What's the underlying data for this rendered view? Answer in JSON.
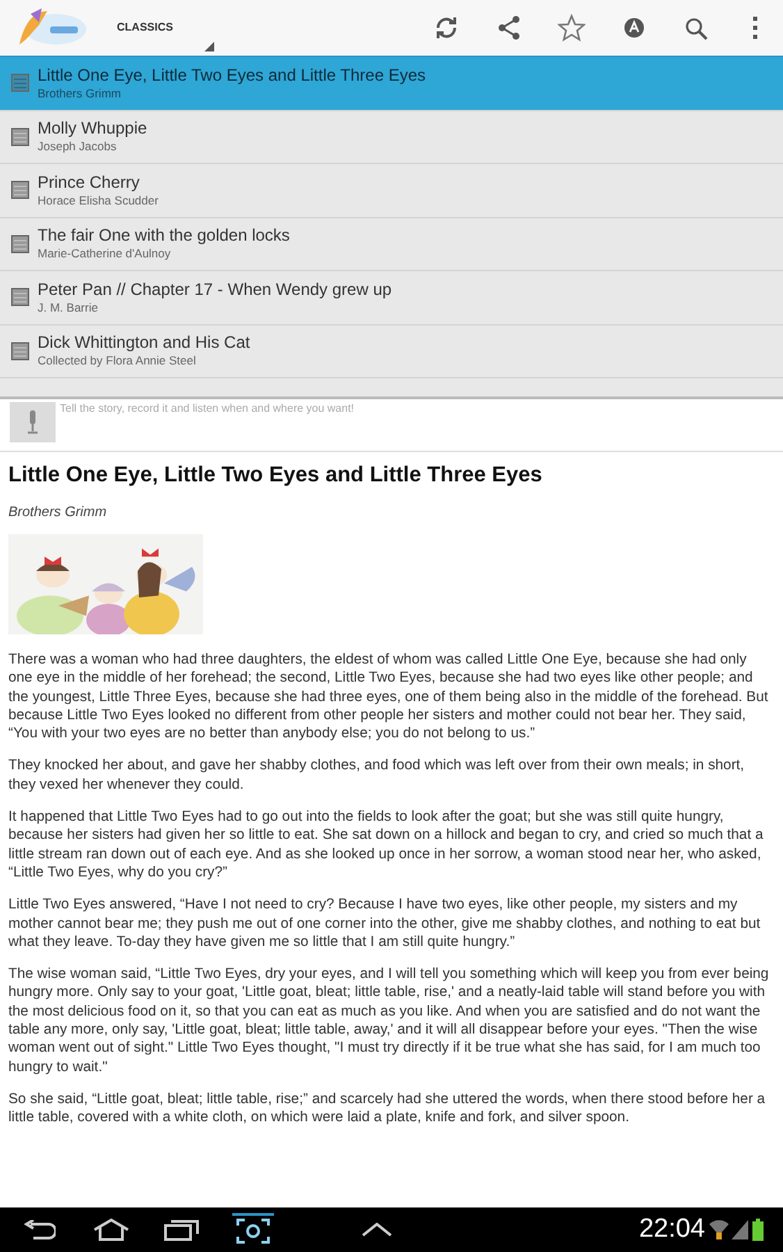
{
  "action_bar": {
    "spinner": "CLASSICS"
  },
  "stories": [
    {
      "title": "Little One Eye, Little Two Eyes and Little Three Eyes",
      "author": "Brothers Grimm",
      "selected": true
    },
    {
      "title": "Molly Whuppie",
      "author": "Joseph Jacobs",
      "selected": false
    },
    {
      "title": "Prince Cherry",
      "author": "Horace Elisha Scudder",
      "selected": false
    },
    {
      "title": "The fair One with the golden locks",
      "author": "Marie-Catherine d'Aulnoy",
      "selected": false
    },
    {
      "title": "Peter Pan // Chapter 17 - When Wendy grew up",
      "author": "J. M. Barrie",
      "selected": false
    },
    {
      "title": "Dick Whittington and His Cat",
      "author": "Collected by Flora Annie Steel",
      "selected": false
    }
  ],
  "record_bar": {
    "hint": "Tell the story, record it and listen when and where you want!"
  },
  "article": {
    "title": "Little One Eye, Little Two Eyes and Little Three Eyes",
    "author": "Brothers Grimm",
    "paragraphs": [
      "There was a woman who had three daughters, the eldest of whom was called Little One Eye, because she had only one eye in the middle of her forehead; the second, Little Two Eyes, because she had two eyes like other people; and the youngest, Little Three Eyes, because she had three eyes, one of them being also in the middle of the forehead. But because Little Two Eyes looked no different from other people her sisters and mother could not bear her. They said, “You with your two eyes are no better than anybody else; you do not belong to us.”",
      "They knocked her about, and gave her shabby clothes, and food which was left over from their own meals; in short, they vexed her whenever they could.",
      "It happened that Little Two Eyes had to go out into the fields to look after the goat; but she was still quite hungry, because her sisters had given her so little to eat. She sat down on a hillock and began to cry, and cried so much that a little stream ran down out of each eye. And as she looked up once in her sorrow, a woman stood near her, who asked, “Little Two Eyes, why do you cry?”",
      "Little Two Eyes answered, “Have I not need to cry? Because I have two eyes, like other people, my sisters and my mother cannot bear me; they push me out of one corner into the other, give me shabby clothes, and nothing to eat but what they leave. To-day they have given me so little that I am still quite hungry.”",
      "The wise woman said, “Little Two Eyes, dry your eyes, and I will tell you something which will keep you from ever being hungry more. Only say to your goat, 'Little goat, bleat; little table, rise,' and a neatly-laid table will stand before you with the most delicious food on it, so that you can eat as much as you like. And when you are satisfied and do not want the table any more, only say, 'Little goat, bleat; little table, away,' and it will all disappear before your eyes. \"Then the wise woman went out of sight.\" Little Two Eyes thought, \"I must try directly if it be true what she has said, for I am much too hungry to wait.\"",
      "So she said, “Little goat, bleat; little table, rise;” and scarcely had she uttered the words, when there stood before her a little table, covered with a white cloth, on which were laid a plate, knife and fork, and silver spoon."
    ]
  },
  "status_bar": {
    "time": "22:04"
  }
}
